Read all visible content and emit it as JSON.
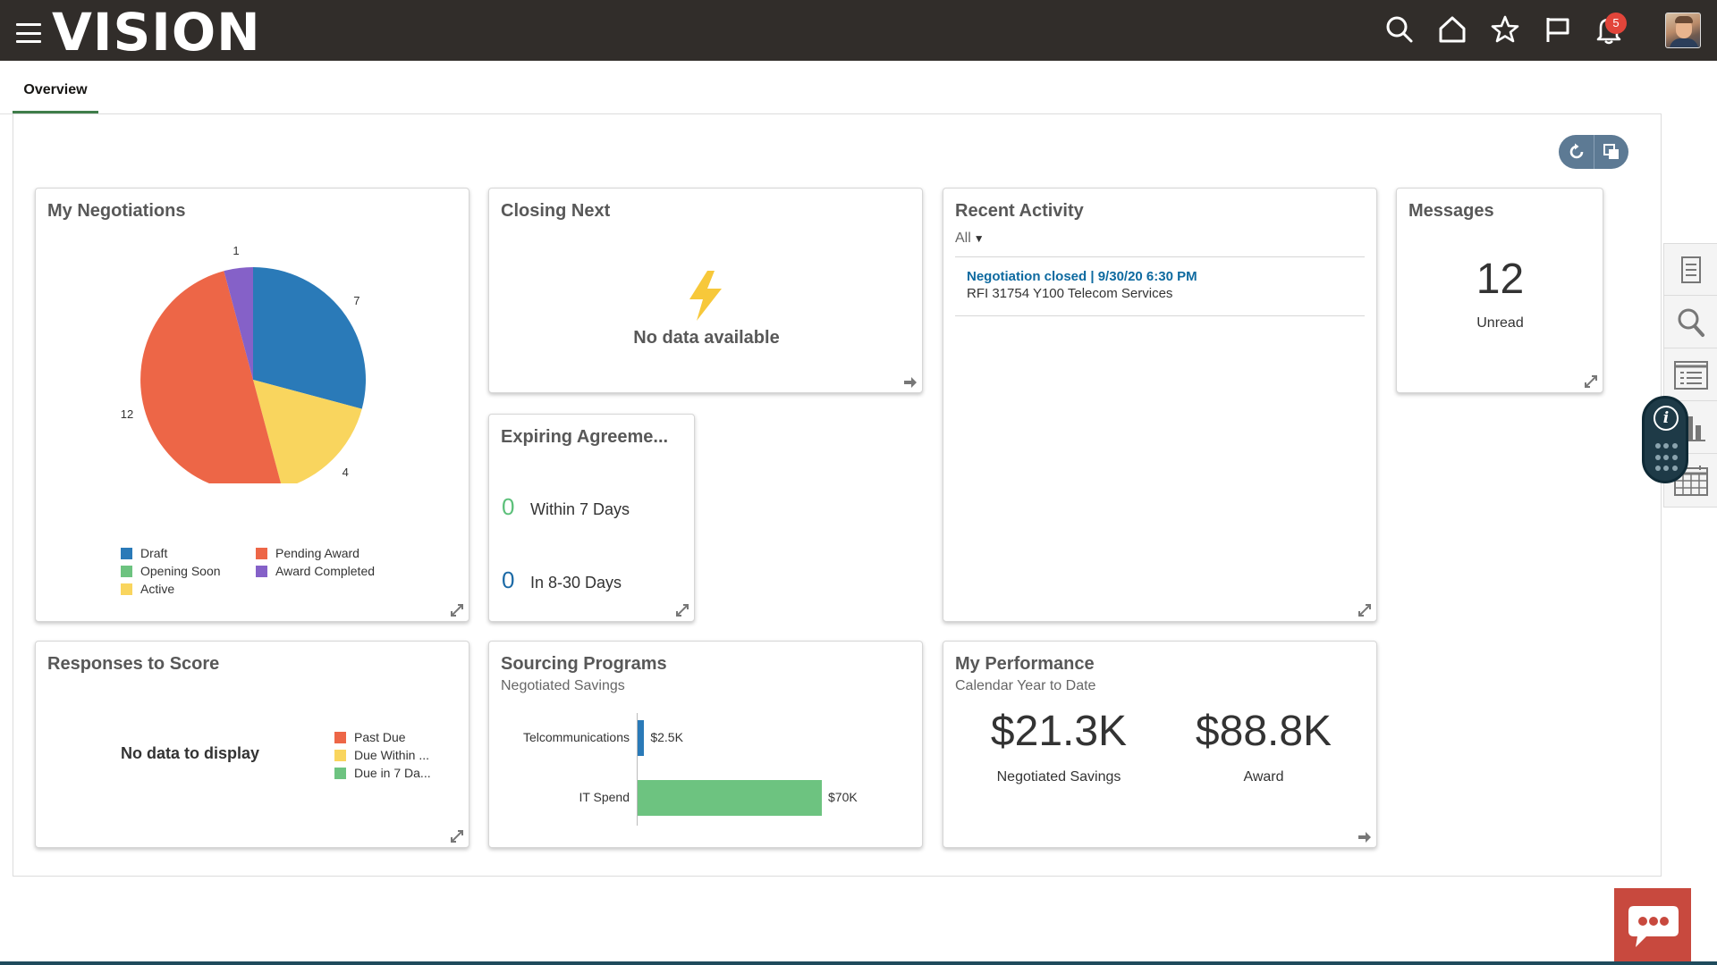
{
  "header": {
    "logo": "VISION",
    "notification_count": "5",
    "icons": [
      "menu-icon",
      "search-icon",
      "home-icon",
      "star-icon",
      "flag-icon",
      "bell-icon",
      "avatar"
    ]
  },
  "tabs": [
    {
      "label": "Overview",
      "active": true
    }
  ],
  "cards": {
    "negotiations": {
      "title": "My Negotiations",
      "chart_data": {
        "type": "pie",
        "title": "My Negotiations",
        "series": [
          {
            "name": "Draft",
            "value": 7,
            "color": "#2a7ab8"
          },
          {
            "name": "Active",
            "value": 4,
            "color": "#f9d55e"
          },
          {
            "name": "Pending Award",
            "value": 12,
            "color": "#ed6647"
          },
          {
            "name": "Award Completed",
            "value": 1,
            "color": "#8561c8"
          }
        ],
        "legend": [
          {
            "name": "Draft",
            "color": "#2a7ab8"
          },
          {
            "name": "Pending Award",
            "color": "#ed6647"
          },
          {
            "name": "Opening Soon",
            "color": "#6dc380"
          },
          {
            "name": "Award Completed",
            "color": "#8561c8"
          },
          {
            "name": "Active",
            "color": "#f9d55e"
          }
        ],
        "legend_placement": "bottom"
      }
    },
    "closing_next": {
      "title": "Closing Next",
      "empty_text": "No data available"
    },
    "expiring": {
      "title": "Expiring Agreeme...",
      "rows": [
        {
          "count": "0",
          "label": "Within 7 Days",
          "color": "#5cc07a"
        },
        {
          "count": "0",
          "label": "In 8-30 Days",
          "color": "#1c6aa6"
        }
      ]
    },
    "recent_activity": {
      "title": "Recent Activity",
      "filter": "All",
      "items": [
        {
          "link": "Negotiation closed | 9/30/20 6:30 PM",
          "desc": "RFI 31754 Y100 Telecom Services"
        }
      ]
    },
    "messages": {
      "title": "Messages",
      "count": "12",
      "label": "Unread"
    },
    "responses": {
      "title": "Responses to Score",
      "empty_text": "No data to display",
      "legend": [
        {
          "name": "Past Due",
          "color": "#ed6647"
        },
        {
          "name": "Due Within ...",
          "color": "#f9d55e"
        },
        {
          "name": "Due in 7 Da...",
          "color": "#6dc380"
        }
      ]
    },
    "sourcing": {
      "title": "Sourcing Programs",
      "subtitle": "Negotiated Savings",
      "chart_data": {
        "type": "bar",
        "orientation": "horizontal",
        "categories": [
          "Telcommunications",
          "IT Spend"
        ],
        "values": [
          2500,
          70000
        ],
        "value_labels": [
          "$2.5K",
          "$70K"
        ],
        "colors": [
          "#2a7ab8",
          "#6dc380"
        ],
        "xlim": [
          0,
          70000
        ]
      }
    },
    "performance": {
      "title": "My Performance",
      "subtitle": "Calendar Year to Date",
      "metrics": [
        {
          "value": "$21.3K",
          "label": "Negotiated Savings"
        },
        {
          "value": "$88.8K",
          "label": "Award"
        }
      ]
    }
  },
  "rail": [
    "document-icon",
    "search-icon",
    "list-icon",
    "bar-chart-icon",
    "calendar-icon"
  ],
  "info_label": "i"
}
